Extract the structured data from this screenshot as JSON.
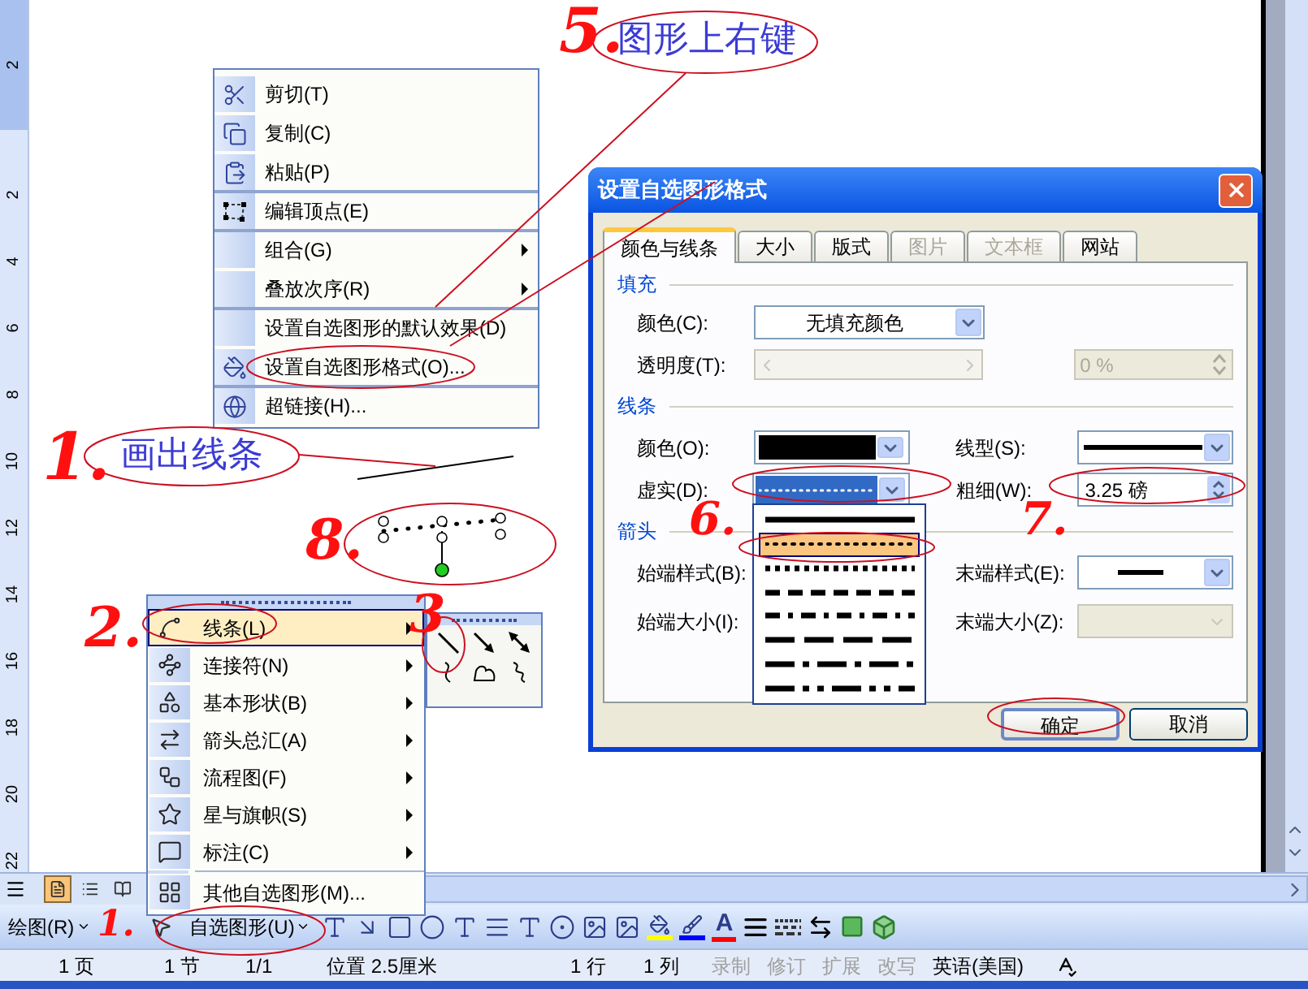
{
  "ruler": {
    "labels": [
      "2",
      "2",
      "4",
      "6",
      "8",
      "10",
      "12",
      "14",
      "16",
      "18",
      "20",
      "22"
    ]
  },
  "callouts": [
    {
      "text": "图形上右键"
    },
    {
      "text": "画出线条"
    }
  ],
  "step_marks": [
    {
      "text": "5."
    },
    {
      "text": "1."
    },
    {
      "text": "8."
    },
    {
      "text": "2."
    },
    {
      "text": "3"
    },
    {
      "text": "6."
    },
    {
      "text": "7."
    },
    {
      "text": "1."
    }
  ],
  "context_menu": {
    "items": [
      {
        "label": "剪切(T)",
        "submenu": false,
        "separator_before": false
      },
      {
        "label": "复制(C)",
        "submenu": false,
        "separator_before": false
      },
      {
        "label": "粘贴(P)",
        "submenu": false,
        "separator_before": false
      },
      {
        "label": "编辑顶点(E)",
        "submenu": false,
        "separator_before": true
      },
      {
        "label": "组合(G)",
        "submenu": true,
        "separator_before": true
      },
      {
        "label": "叠放次序(R)",
        "submenu": true,
        "separator_before": false
      },
      {
        "label": "设置自选图形的默认效果(D)",
        "submenu": false,
        "separator_before": true
      },
      {
        "label": "设置自选图形格式(O)...",
        "submenu": false,
        "separator_before": false
      },
      {
        "label": "超链接(H)...",
        "submenu": false,
        "separator_before": true
      }
    ]
  },
  "dialog": {
    "title": "设置自选图形格式",
    "tabs": [
      {
        "label": "颜色与线条",
        "selected": true,
        "disabled": false
      },
      {
        "label": "大小",
        "selected": false,
        "disabled": false
      },
      {
        "label": "版式",
        "selected": false,
        "disabled": false
      },
      {
        "label": "图片",
        "selected": false,
        "disabled": true
      },
      {
        "label": "文本框",
        "selected": false,
        "disabled": true
      },
      {
        "label": "网站",
        "selected": false,
        "disabled": false
      }
    ],
    "fill": {
      "heading": "填充",
      "color_label": "颜色(C):",
      "color_value": "无填充颜色",
      "transparency_label": "透明度(T):",
      "transparency_value": "0 %",
      "transparency_disabled": true
    },
    "line": {
      "heading": "线条",
      "color_label": "颜色(O):",
      "style_label": "线型(S):",
      "dash_label": "虚实(D):",
      "weight_label": "粗细(W):",
      "weight_value": "3.25 磅"
    },
    "arrows": {
      "heading": "箭头",
      "begin_style_label": "始端样式(B):",
      "end_style_label": "末端样式(E):",
      "begin_size_label": "始端大小(I):",
      "end_size_label": "末端大小(Z):",
      "end_size_disabled": true
    },
    "dash_options": [
      {
        "kind": "solid",
        "selected": false
      },
      {
        "kind": "round-dot",
        "selected": true
      },
      {
        "kind": "square-dot",
        "selected": false
      },
      {
        "kind": "dash",
        "selected": false
      },
      {
        "kind": "dash-dot",
        "selected": false
      },
      {
        "kind": "long-dash",
        "selected": false
      },
      {
        "kind": "long-dash-dot",
        "selected": false
      },
      {
        "kind": "long-dash-dot-dot",
        "selected": false
      }
    ],
    "buttons": [
      {
        "label": "确定",
        "default": true
      },
      {
        "label": "取消",
        "default": false
      }
    ]
  },
  "autoshapes_menu": {
    "items": [
      {
        "label": "线条(L)",
        "submenu": true,
        "selected": true,
        "separator_before": false
      },
      {
        "label": "连接符(N)",
        "submenu": true,
        "selected": false,
        "separator_before": false
      },
      {
        "label": "基本形状(B)",
        "submenu": true,
        "selected": false,
        "separator_before": false
      },
      {
        "label": "箭头总汇(A)",
        "submenu": true,
        "selected": false,
        "separator_before": false
      },
      {
        "label": "流程图(F)",
        "submenu": true,
        "selected": false,
        "separator_before": false
      },
      {
        "label": "星与旗帜(S)",
        "submenu": true,
        "selected": false,
        "separator_before": false
      },
      {
        "label": "标注(C)",
        "submenu": true,
        "selected": false,
        "separator_before": false
      },
      {
        "label": "其他自选图形(M)...",
        "submenu": false,
        "selected": false,
        "separator_before": true
      }
    ]
  },
  "view_buttons": [
    {
      "selected": true
    },
    {
      "selected": false
    },
    {
      "selected": false
    }
  ],
  "drawing_toolbar": {
    "draw_menu": "绘图(R)",
    "autoshapes_button": "自选图形(U)",
    "font_color_glyph": "A"
  },
  "status_bar": {
    "items": [
      {
        "text": "1 页",
        "disabled": false
      },
      {
        "text": "1 节",
        "disabled": false
      },
      {
        "text": "1/1",
        "disabled": false
      },
      {
        "text": "位置 2.5厘米",
        "disabled": false
      },
      {
        "text": "1 行",
        "disabled": false
      },
      {
        "text": "1 列",
        "disabled": false
      },
      {
        "text": "录制",
        "disabled": true
      },
      {
        "text": "修订",
        "disabled": true
      },
      {
        "text": "扩展",
        "disabled": true
      },
      {
        "text": "改写",
        "disabled": true
      },
      {
        "text": "英语(美国)",
        "disabled": false
      }
    ]
  }
}
